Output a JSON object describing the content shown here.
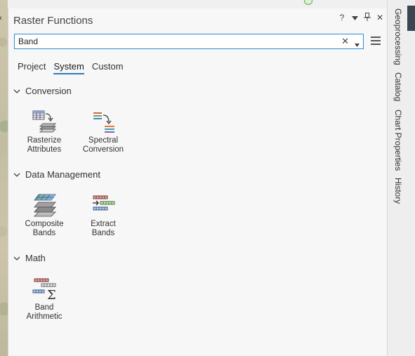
{
  "panel": {
    "title": "Raster Functions",
    "controls": {
      "help": "?",
      "menu_icon": "chevron-down-icon",
      "pin_icon": "pin-icon",
      "close": "✕"
    }
  },
  "search": {
    "value": "Band",
    "placeholder": ""
  },
  "tabs": [
    {
      "label": "Project",
      "active": false
    },
    {
      "label": "System",
      "active": true
    },
    {
      "label": "Custom",
      "active": false
    }
  ],
  "sections": [
    {
      "title": "Conversion",
      "tools": [
        {
          "line1": "Rasterize",
          "line2": "Attributes",
          "icon": "rasterize-attributes-icon"
        },
        {
          "line1": "Spectral",
          "line2": "Conversion",
          "icon": "spectral-conversion-icon"
        }
      ]
    },
    {
      "title": "Data Management",
      "tools": [
        {
          "line1": "Composite",
          "line2": "Bands",
          "icon": "composite-bands-icon"
        },
        {
          "line1": "Extract",
          "line2": "Bands",
          "icon": "extract-bands-icon"
        }
      ]
    },
    {
      "title": "Math",
      "tools": [
        {
          "line1": "Band",
          "line2": "Arithmetic",
          "icon": "band-arithmetic-icon"
        }
      ]
    }
  ],
  "dock_tabs": [
    "Geoprocessing",
    "Catalog",
    "Chart Properties",
    "History"
  ],
  "colors": {
    "accent": "#2b7bc0",
    "search_border": "#2b8bd0"
  }
}
